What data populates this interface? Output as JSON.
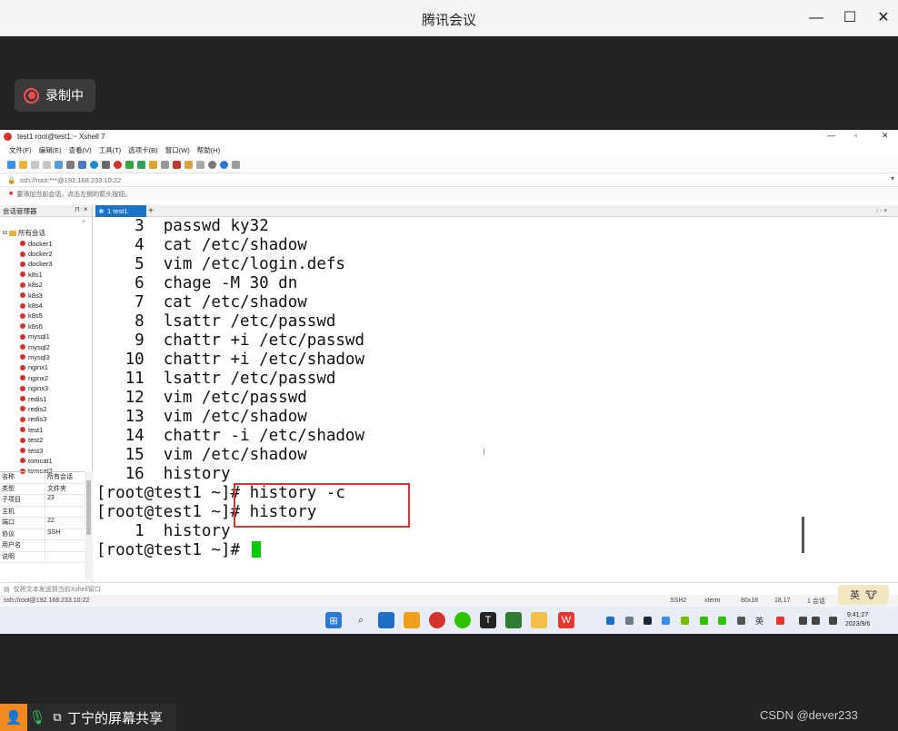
{
  "meeting": {
    "title": "腾讯会议",
    "record_label": "录制中",
    "share_label": "丁宁的屏幕共享",
    "watermark": "CSDN @dever233",
    "controls": {
      "minimize": "—",
      "maximize": "☐",
      "close": "✕"
    }
  },
  "xshell": {
    "window_title": "test1   root@test1:~   Xshell 7",
    "menu": [
      "文件(F)",
      "编辑(E)",
      "查看(V)",
      "工具(T)",
      "选项卡(B)",
      "窗口(W)",
      "帮助(H)"
    ],
    "address": "ssh://root:***@192.168.233.10:22",
    "hint": "要添加当前会话，点击左侧的箭头按钮。",
    "sidebar": {
      "header": "会话管理器",
      "root_label": "所有会话",
      "sessions": [
        "docker1",
        "docker2",
        "docker3",
        "k8s1",
        "k8s2",
        "k8s3",
        "k8s4",
        "k8s5",
        "k8s6",
        "mysql1",
        "mysql2",
        "mysql3",
        "nginx1",
        "nginx2",
        "nginx3",
        "redis1",
        "redis2",
        "redis3",
        "test1",
        "test2",
        "test3",
        "tomcat1",
        "tomcat2"
      ],
      "props": [
        [
          "名称",
          "所有会话"
        ],
        [
          "类型",
          "文件夹"
        ],
        [
          "子项目",
          "23"
        ],
        [
          "主机",
          ""
        ],
        [
          "端口",
          "22"
        ],
        [
          "协议",
          "SSH"
        ],
        [
          "用户名",
          ""
        ],
        [
          "说明",
          ""
        ]
      ]
    },
    "tab_label": "1 test1",
    "tab_add": "+",
    "terminal_lines": [
      "    3  passwd ky32",
      "    4  cat /etc/shadow",
      "    5  vim /etc/login.defs",
      "    6  chage -M 30 dn",
      "    7  cat /etc/shadow",
      "    8  lsattr /etc/passwd",
      "    9  chattr +i /etc/passwd",
      "   10  chattr +i /etc/shadow",
      "   11  lsattr /etc/passwd",
      "   12  vim /etc/passwd",
      "   13  vim /etc/shadow",
      "   14  chattr -i /etc/shadow",
      "   15  vim /etc/shadow",
      "   16  history",
      "[root@test1 ~]# history -c",
      "[root@test1 ~]# history",
      "    1  history"
    ],
    "prompt": "[root@test1 ~]# ",
    "send_bar": "仅将文本发送到当前Xshell窗口",
    "status": {
      "left": "ssh://root@192.168.233.10:22",
      "protocol": "SSH2",
      "terminal": "xterm",
      "size": "80x18",
      "cursor_pos": "18,17",
      "sessions": "1 会话"
    },
    "ime": {
      "lang": "英",
      "icon": "🐮"
    }
  },
  "taskbar": {
    "time": "9:41:27",
    "date": "2023/9/6",
    "tray_lang": "英",
    "accent": "#1a73c7"
  }
}
